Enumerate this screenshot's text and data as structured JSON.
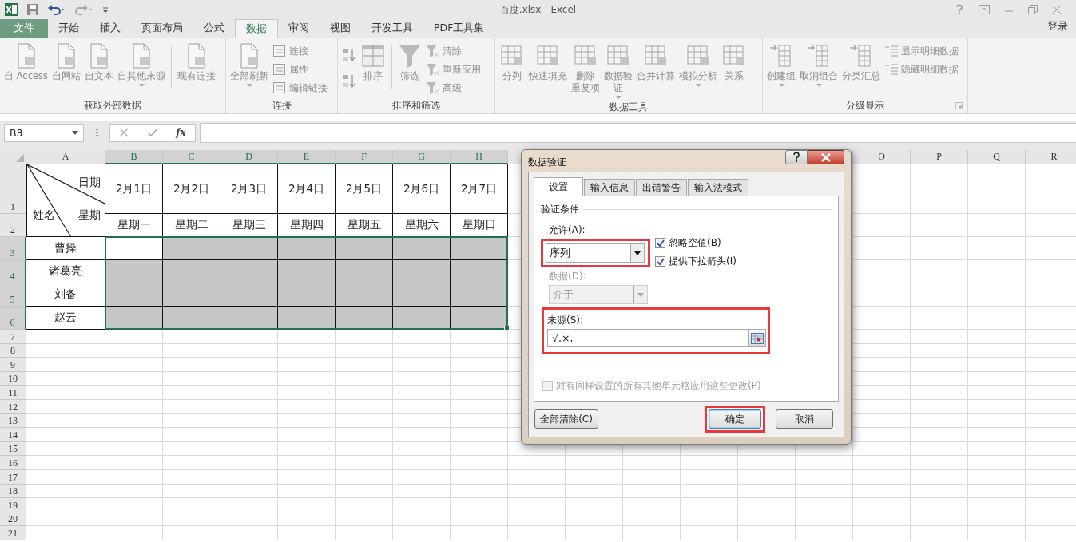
{
  "window": {
    "title": "百度.xlsx - Excel"
  },
  "tabs": [
    {
      "label": "文件",
      "kind": "file",
      "selected": false
    },
    {
      "label": "开始",
      "kind": "tab",
      "selected": false
    },
    {
      "label": "插入",
      "kind": "tab",
      "selected": false
    },
    {
      "label": "页面布局",
      "kind": "tab",
      "selected": false
    },
    {
      "label": "公式",
      "kind": "tab",
      "selected": false
    },
    {
      "label": "数据",
      "kind": "tab",
      "selected": true
    },
    {
      "label": "审阅",
      "kind": "tab",
      "selected": false
    },
    {
      "label": "视图",
      "kind": "tab",
      "selected": false
    },
    {
      "label": "开发工具",
      "kind": "tab",
      "selected": false
    },
    {
      "label": "PDF工具集",
      "kind": "tab",
      "selected": false
    }
  ],
  "account": {
    "label": "登录"
  },
  "ribbon": {
    "groups": [
      {
        "label": "获取外部数据",
        "launcher": false,
        "columns": [
          {
            "kind": "large",
            "label": "自 Access",
            "dropdown": false
          },
          {
            "kind": "large",
            "label": "自网站",
            "dropdown": false
          },
          {
            "kind": "large",
            "label": "自文本",
            "dropdown": false
          },
          {
            "kind": "large",
            "label": "自其他来源",
            "dropdown": true
          },
          {
            "kind": "separator"
          },
          {
            "kind": "large",
            "label": "现有连接",
            "dropdown": false
          }
        ]
      },
      {
        "label": "连接",
        "launcher": false,
        "columns": [
          {
            "kind": "large",
            "label": "全部刷新",
            "dropdown": true
          },
          {
            "kind": "stack",
            "items": [
              {
                "kind": "labeled",
                "label": "连接"
              },
              {
                "kind": "labeled",
                "label": "属性"
              },
              {
                "kind": "labeled",
                "label": "编辑链接"
              }
            ]
          }
        ]
      },
      {
        "label": "排序和筛选",
        "launcher": false,
        "columns": [
          {
            "kind": "stack",
            "items": [
              {
                "kind": "icon"
              },
              {
                "kind": "icon"
              }
            ]
          },
          {
            "kind": "large",
            "label": "排序",
            "dropdown": false
          },
          {
            "kind": "separator"
          },
          {
            "kind": "large",
            "label": "筛选",
            "dropdown": false
          },
          {
            "kind": "stack",
            "items": [
              {
                "kind": "labeled",
                "label": "清除"
              },
              {
                "kind": "labeled",
                "label": "重新应用"
              },
              {
                "kind": "labeled",
                "label": "高级"
              }
            ]
          }
        ]
      },
      {
        "label": "数据工具",
        "launcher": false,
        "columns": [
          {
            "kind": "large",
            "label": "分列",
            "dropdown": false
          },
          {
            "kind": "large",
            "label": "快速填充",
            "dropdown": false
          },
          {
            "kind": "large",
            "lines": [
              "删除",
              "重复项"
            ],
            "dropdown": false
          },
          {
            "kind": "large",
            "lines": [
              "数据验",
              "证"
            ],
            "dropdown": true
          },
          {
            "kind": "large",
            "label": "合并计算",
            "dropdown": false
          },
          {
            "kind": "large",
            "label": "模拟分析",
            "dropdown": true
          },
          {
            "kind": "large",
            "label": "关系",
            "dropdown": false
          }
        ]
      },
      {
        "label": "分级显示",
        "launcher": true,
        "columns": [
          {
            "kind": "large",
            "label": "创建组",
            "dropdown": true
          },
          {
            "kind": "large",
            "label": "取消组合",
            "dropdown": true
          },
          {
            "kind": "large",
            "label": "分类汇总",
            "dropdown": false
          },
          {
            "kind": "stack",
            "items": [
              {
                "kind": "labeled",
                "label": "显示明细数据"
              },
              {
                "kind": "labeled",
                "label": "隐藏明细数据"
              }
            ]
          }
        ]
      }
    ]
  },
  "formula_bar": {
    "name_box": "B3",
    "function_label": "fx"
  },
  "sheet": {
    "columns": [
      {
        "label": "A",
        "selected": false
      },
      {
        "label": "B",
        "selected": true
      },
      {
        "label": "C",
        "selected": true
      },
      {
        "label": "D",
        "selected": true
      },
      {
        "label": "E",
        "selected": true
      },
      {
        "label": "F",
        "selected": true
      },
      {
        "label": "G",
        "selected": true
      },
      {
        "label": "H",
        "selected": true
      }
    ],
    "right_columns": [
      {
        "label": "O",
        "selected": false
      },
      {
        "label": "P",
        "selected": false
      },
      {
        "label": "Q",
        "selected": false
      },
      {
        "label": "R",
        "selected": false
      }
    ],
    "rows": [
      {
        "label": "1",
        "selected": false
      },
      {
        "label": "2",
        "selected": false
      },
      {
        "label": "3",
        "selected": true
      },
      {
        "label": "4",
        "selected": true
      },
      {
        "label": "5",
        "selected": true
      },
      {
        "label": "6",
        "selected": true
      },
      {
        "label": "7",
        "selected": false
      },
      {
        "label": "8",
        "selected": false
      },
      {
        "label": "9",
        "selected": false
      },
      {
        "label": "10",
        "selected": false
      },
      {
        "label": "11",
        "selected": false
      },
      {
        "label": "12",
        "selected": false
      },
      {
        "label": "13",
        "selected": false
      },
      {
        "label": "14",
        "selected": false
      },
      {
        "label": "15",
        "selected": false
      },
      {
        "label": "16",
        "selected": false
      },
      {
        "label": "17",
        "selected": false
      },
      {
        "label": "18",
        "selected": false
      },
      {
        "label": "19",
        "selected": false
      },
      {
        "label": "20",
        "selected": false
      },
      {
        "label": "21",
        "selected": false
      }
    ],
    "corner_header": {
      "top_right": "日期",
      "middle_right": "星期",
      "bottom_left": "姓名"
    },
    "dates": [
      "2月1日",
      "2月2日",
      "2月3日",
      "2月4日",
      "2月5日",
      "2月6日",
      "2月7日"
    ],
    "weekdays": [
      "星期一",
      "星期二",
      "星期三",
      "星期四",
      "星期五",
      "星期六",
      "星期日"
    ],
    "people": [
      {
        "name": "曹操",
        "cells": [
          {
            "selected": true,
            "active": true
          },
          {
            "selected": true,
            "active": false
          },
          {
            "selected": true,
            "active": false
          },
          {
            "selected": true,
            "active": false
          },
          {
            "selected": true,
            "active": false
          },
          {
            "selected": true,
            "active": false
          },
          {
            "selected": true,
            "active": false
          }
        ]
      },
      {
        "name": "诸葛亮",
        "cells": [
          {
            "selected": true,
            "active": false
          },
          {
            "selected": true,
            "active": false
          },
          {
            "selected": true,
            "active": false
          },
          {
            "selected": true,
            "active": false
          },
          {
            "selected": true,
            "active": false
          },
          {
            "selected": true,
            "active": false
          },
          {
            "selected": true,
            "active": false
          }
        ]
      },
      {
        "name": "刘备",
        "cells": [
          {
            "selected": true,
            "active": false
          },
          {
            "selected": true,
            "active": false
          },
          {
            "selected": true,
            "active": false
          },
          {
            "selected": true,
            "active": false
          },
          {
            "selected": true,
            "active": false
          },
          {
            "selected": true,
            "active": false
          },
          {
            "selected": true,
            "active": false
          }
        ]
      },
      {
        "name": "赵云",
        "cells": [
          {
            "selected": true,
            "active": false
          },
          {
            "selected": true,
            "active": false
          },
          {
            "selected": true,
            "active": false
          },
          {
            "selected": true,
            "active": false
          },
          {
            "selected": true,
            "active": false
          },
          {
            "selected": true,
            "active": false
          },
          {
            "selected": true,
            "active": false
          }
        ]
      }
    ]
  },
  "dialog": {
    "title": "数据验证",
    "tabs": [
      {
        "label": "设置",
        "selected": true
      },
      {
        "label": "输入信息",
        "selected": false
      },
      {
        "label": "出错警告",
        "selected": false
      },
      {
        "label": "输入法模式",
        "selected": false
      }
    ],
    "section": "验证条件",
    "allow": {
      "label": "允许(A):",
      "value": "序列",
      "highlighted": true
    },
    "options": [
      {
        "label": "忽略空值(B)",
        "checked": true
      },
      {
        "label": "提供下拉箭头(I)",
        "checked": true
      }
    ],
    "data": {
      "label": "数据(D):",
      "value": "介于",
      "disabled": true
    },
    "source": {
      "label": "来源(S):",
      "value": "√,×,",
      "highlighted": true
    },
    "apply_all": {
      "label": "对有同样设置的所有其他单元格应用这些更改(P)",
      "checked": false,
      "disabled": true
    },
    "buttons": [
      {
        "label": "全部清除(C)",
        "kind": "clear",
        "highlighted": false
      },
      {
        "label": "确定",
        "kind": "ok",
        "highlighted": true
      },
      {
        "label": "取消",
        "kind": "cancel",
        "highlighted": false
      }
    ]
  }
}
